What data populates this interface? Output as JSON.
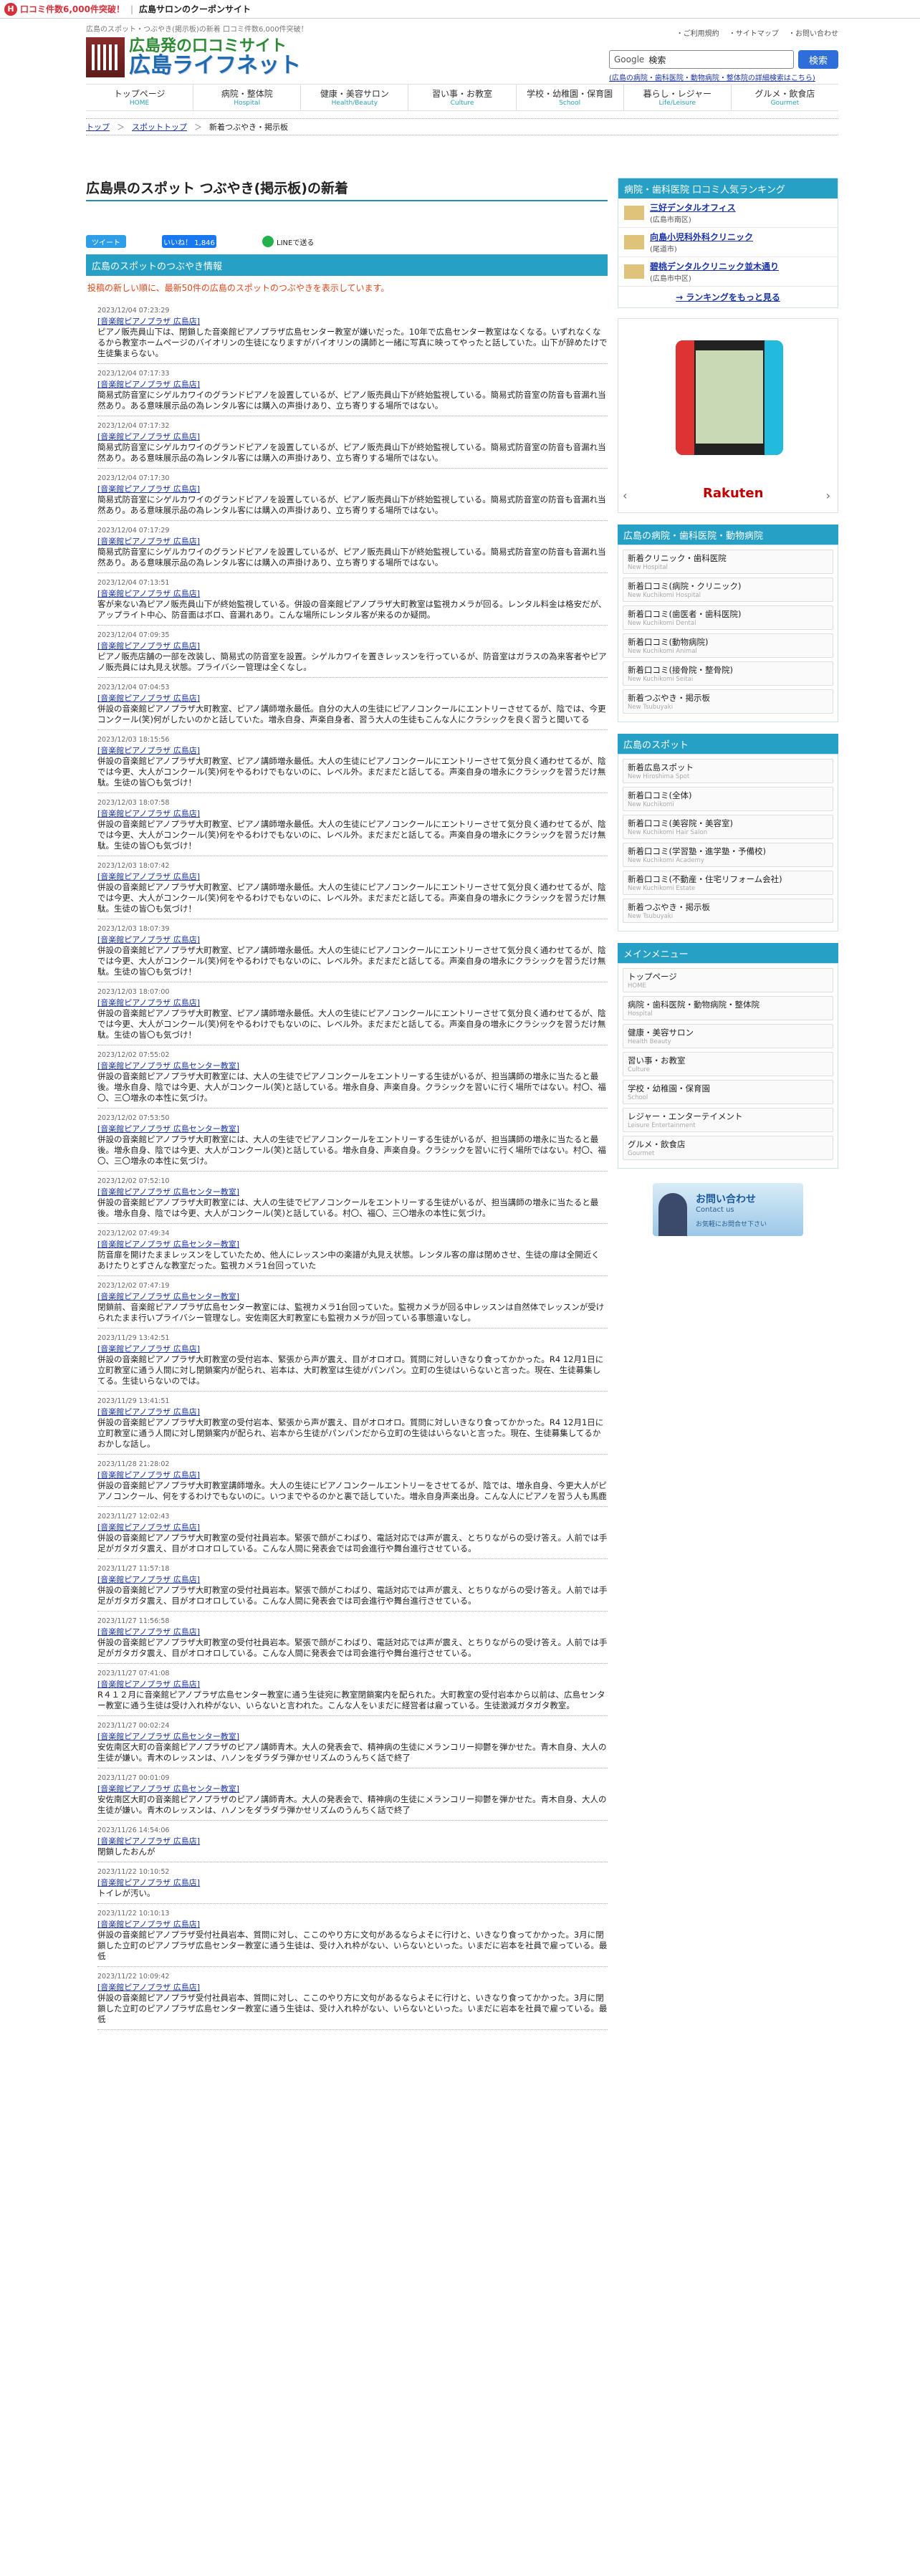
{
  "topbar": {
    "mark": "H",
    "promo": "口コミ件数6,000件突破！",
    "title": "広島サロンのクーポンサイト"
  },
  "header": {
    "tagline": "広島のスポット・つぶやき(掲示板)の新着 口コミ件数6,000件突破！",
    "utility": [
      "・ご利用規約",
      "・サイトマップ",
      "・お問い合わせ"
    ],
    "logo_line1": "広島発の口コミサイト",
    "logo_line2": "広島ライフネット",
    "search": {
      "brand": "Google",
      "placeholder": "検索",
      "button": "検索",
      "hint": "(広島の病院・歯科医院・動物病院・整体院の詳細検索はこちら)"
    }
  },
  "nav": [
    {
      "ja": "トップページ",
      "en": "HOME"
    },
    {
      "ja": "病院・整体院",
      "en": "Hospital"
    },
    {
      "ja": "健康・美容サロン",
      "en": "Health/Beauty"
    },
    {
      "ja": "習い事・お教室",
      "en": "Culture"
    },
    {
      "ja": "学校・幼稚園・保育園",
      "en": "School"
    },
    {
      "ja": "暮らし・レジャー",
      "en": "Life/Leisure"
    },
    {
      "ja": "グルメ・飲食店",
      "en": "Gourmet"
    }
  ],
  "breadcrumb": [
    "トップ",
    "スポットトップ",
    "新着つぶやき・掲示板"
  ],
  "page_title": "広島県のスポット つぶやき(掲示板)の新着",
  "social": {
    "twitter": "ツイート",
    "facebook": "いいね！ 1,846",
    "line": "LINEで送る"
  },
  "section": {
    "title": "広島のスポットのつぶやき情報",
    "note": "投稿の新しい順に、最新50件の広島のスポットのつぶやきを表示しています。"
  },
  "entries": [
    {
      "date": "2023/12/04 07:23:29",
      "shop": "[音楽館ピアノプラザ 広島店]",
      "text": "ピアノ販売員山下は、閉鎖した音楽館ピアノプラザ広島センター教室が嫌いだった。10年で広島センター教室はなくなる。いずれなくなるから教室ホームページのバイオリンの生徒になりますがバイオリンの講師と一緒に写真に映ってやったと話していた。山下が辞めたけで生徒集まらない。"
    },
    {
      "date": "2023/12/04 07:17:33",
      "shop": "[音楽館ピアノプラザ 広島店]",
      "text": "簡易式防音室にシゲルカワイのグランドピアノを設置しているが、ピアノ販売員山下が終始監視している。簡易式防音室の防音も音漏れ当然あり。ある意味展示品の為レンタル客には購入の声掛けあり、立ち寄りする場所ではない。"
    },
    {
      "date": "2023/12/04 07:17:32",
      "shop": "[音楽館ピアノプラザ 広島店]",
      "text": "簡易式防音室にシゲルカワイのグランドピアノを設置しているが、ピアノ販売員山下が終始監視している。簡易式防音室の防音も音漏れ当然あり。ある意味展示品の為レンタル客には購入の声掛けあり、立ち寄りする場所ではない。"
    },
    {
      "date": "2023/12/04 07:17:30",
      "shop": "[音楽館ピアノプラザ 広島店]",
      "text": "簡易式防音室にシゲルカワイのグランドピアノを設置しているが、ピアノ販売員山下が終始監視している。簡易式防音室の防音も音漏れ当然あり。ある意味展示品の為レンタル客には購入の声掛けあり、立ち寄りする場所ではない。"
    },
    {
      "date": "2023/12/04 07:17:29",
      "shop": "[音楽館ピアノプラザ 広島店]",
      "text": "簡易式防音室にシゲルカワイのグランドピアノを設置しているが、ピアノ販売員山下が終始監視している。簡易式防音室の防音も音漏れ当然あり。ある意味展示品の為レンタル客には購入の声掛けあり、立ち寄りする場所ではない。"
    },
    {
      "date": "2023/12/04 07:13:51",
      "shop": "[音楽館ピアノプラザ 広島店]",
      "text": "客が来ない為ピアノ販売員山下が終始監視している。併設の音楽館ピアノプラザ大町教室は監視カメラが回る。レンタル料金は格安だが、アップライト中心、防音面はボロ、音漏れあり。こんな場所にレンタル客が来るのか疑問。"
    },
    {
      "date": "2023/12/04 07:09:35",
      "shop": "[音楽館ピアノプラザ 広島店]",
      "text": "ピアノ販売店舗の一部を改装し、簡易式の防音室を設置。シゲルカワイを置きレッスンを行っているが、防音室はガラスの為来客者やピアノ販売員には丸見え状態。プライバシー管理は全くなし。"
    },
    {
      "date": "2023/12/04 07:04:53",
      "shop": "[音楽館ピアノプラザ 広島店]",
      "text": "併設の音楽館ピアノプラザ大町教室、ピアノ講師増永最低。自分の大人の生徒にピアノコンクールにエントリーさせてるが、陰では、今更コンクール(笑)何がしたいのかと話していた。増永自身、声楽自身者、習う大人の生徒もこんな人にクラシックを良く習うと聞いてる"
    },
    {
      "date": "2023/12/03 18:15:56",
      "shop": "[音楽館ピアノプラザ 広島店]",
      "text": "併設の音楽館ピアノプラザ大町教室、ピアノ講師増永最低。大人の生徒にピアノコンクールにエントリーさせて気分良く通わせてるが、陰では今更、大人がコンクール(笑)何をやるわけでもないのに、レベル外。まだまだと話してる。声楽自身の増永にクラシックを習うだけ無駄。生徒の皆〇も気づけ！"
    },
    {
      "date": "2023/12/03 18:07:58",
      "shop": "[音楽館ピアノプラザ 広島店]",
      "text": "併設の音楽館ピアノプラザ大町教室、ピアノ講師増永最低。大人の生徒にピアノコンクールにエントリーさせて気分良く通わせてるが、陰では今更、大人がコンクール(笑)何をやるわけでもないのに、レベル外。まだまだと話してる。声楽自身の増永にクラシックを習うだけ無駄。生徒の皆〇も気づけ！"
    },
    {
      "date": "2023/12/03 18:07:42",
      "shop": "[音楽館ピアノプラザ 広島店]",
      "text": "併設の音楽館ピアノプラザ大町教室、ピアノ講師増永最低。大人の生徒にピアノコンクールにエントリーさせて気分良く通わせてるが、陰では今更、大人がコンクール(笑)何をやるわけでもないのに、レベル外。まだまだと話してる。声楽自身の増永にクラシックを習うだけ無駄。生徒の皆〇も気づけ！"
    },
    {
      "date": "2023/12/03 18:07:39",
      "shop": "[音楽館ピアノプラザ 広島店]",
      "text": "併設の音楽館ピアノプラザ大町教室、ピアノ講師増永最低。大人の生徒にピアノコンクールにエントリーさせて気分良く通わせてるが、陰では今更、大人がコンクール(笑)何をやるわけでもないのに、レベル外。まだまだと話してる。声楽自身の増永にクラシックを習うだけ無駄。生徒の皆〇も気づけ！"
    },
    {
      "date": "2023/12/03 18:07:00",
      "shop": "[音楽館ピアノプラザ 広島店]",
      "text": "併設の音楽館ピアノプラザ大町教室、ピアノ講師増永最低。大人の生徒にピアノコンクールにエントリーさせて気分良く通わせてるが、陰では今更、大人がコンクール(笑)何をやるわけでもないのに、レベル外。まだまだと話してる。声楽自身の増永にクラシックを習うだけ無駄。生徒の皆〇も気づけ！"
    },
    {
      "date": "2023/12/02 07:55:02",
      "shop": "[音楽館ピアノプラザ 広島センター教室]",
      "text": "併設の音楽館ピアノプラザ大町教室には、大人の生徒でピアノコンクールをエントリーする生徒がいるが、担当講師の増永に当たると最後。増永自身、陰では今更、大人がコンクール(笑)と話している。増永自身、声楽自身。クラシックを習いに行く場所ではない。村〇、福〇、三〇増永の本性に気づけ。"
    },
    {
      "date": "2023/12/02 07:53:50",
      "shop": "[音楽館ピアノプラザ 広島センター教室]",
      "text": "併設の音楽館ピアノプラザ大町教室には、大人の生徒でピアノコンクールをエントリーする生徒がいるが、担当講師の増永に当たると最後。増永自身、陰では今更、大人がコンクール(笑)と話している。増永自身、声楽自身。クラシックを習いに行く場所ではない。村〇、福〇、三〇増永の本性に気づけ。"
    },
    {
      "date": "2023/12/02 07:52:10",
      "shop": "[音楽館ピアノプラザ 広島センター教室]",
      "text": "併設の音楽館ピアノプラザ大町教室には、大人の生徒でピアノコンクールをエントリーする生徒がいるが、担当講師の増永に当たると最後。増永自身、陰では今更、大人がコンクール(笑)と話している。村〇、福〇、三〇増永の本性に気づけ。"
    },
    {
      "date": "2023/12/02 07:49:34",
      "shop": "[音楽館ピアノプラザ 広島センター教室]",
      "text": "防音扉を開けたままレッスンをしていたため、他人にレッスン中の楽譜が丸見え状態。レンタル客の扉は閉めさせ、生徒の扉は全開近くあけたりとずさんな教室だった。監視カメラ1台回っていた"
    },
    {
      "date": "2023/12/02 07:47:19",
      "shop": "[音楽館ピアノプラザ 広島センター教室]",
      "text": "閉鎖前、音楽館ピアノプラザ広島センター教室には、監視カメラ1台回っていた。監視カメラが回る中レッスンは自然体でレッスンが受けられたまま行いプライバシー管理なし。安佐南区大町教室にも監視カメラが回っている事態違いなし。"
    },
    {
      "date": "2023/11/29 13:42:51",
      "shop": "[音楽館ピアノプラザ 広島店]",
      "text": "併設の音楽館ピアノプラザ大町教室の受付岩本、緊張から声が震え、目がオロオロ。質問に対しいきなり食ってかかった。R4 12月1日に立町教室に通う人間に対し閉鎖案内が配られ、岩本は、大町教室は生徒がパンパン。立町の生徒はいらないと言った。現在、生徒募集してる。生徒いらないのでは。"
    },
    {
      "date": "2023/11/29 13:41:51",
      "shop": "[音楽館ピアノプラザ 広島店]",
      "text": "併設の音楽館ピアノプラザ大町教室の受付岩本、緊張から声が震え、目がオロオロ。質問に対しいきなり食ってかかった。R4 12月1日に立町教室に通う人間に対し閉鎖案内が配られ、岩本から生徒がパンパンだから立町の生徒はいらないと言った。現在、生徒募集してるかおかしな話し。"
    },
    {
      "date": "2023/11/28 21:28:02",
      "shop": "[音楽館ピアノプラザ 広島店]",
      "text": "併設の音楽館ピアノプラザ大町教室講師増永。大人の生徒にピアノコンクールエントリーをさせてるが、陰では、増永自身、今更大人がピアノコンクール、何をするわけでもないのに。いつまでやるのかと裏で話していた。増永自身声楽出身。こんな人にピアノを習う人も馬鹿"
    },
    {
      "date": "2023/11/27 12:02:43",
      "shop": "[音楽館ピアノプラザ 広島店]",
      "text": "併設の音楽館ピアノプラザ大町教室の受付社員岩本。緊張で顔がこわばり、電話対応では声が震え、とちりながらの受け答え。人前では手足がガタガタ震え、目がオロオロしている。こんな人間に発表会では司会進行や舞台進行させている。"
    },
    {
      "date": "2023/11/27 11:57:18",
      "shop": "[音楽館ピアノプラザ 広島店]",
      "text": "併設の音楽館ピアノプラザ大町教室の受付社員岩本。緊張で顔がこわばり、電話対応では声が震え、とちりながらの受け答え。人前では手足がガタガタ震え、目がオロオロしている。こんな人間に発表会では司会進行や舞台進行させている。"
    },
    {
      "date": "2023/11/27 11:56:58",
      "shop": "[音楽館ピアノプラザ 広島店]",
      "text": "併設の音楽館ピアノプラザ大町教室の受付社員岩本。緊張で顔がこわばり、電話対応では声が震え、とちりながらの受け答え。人前では手足がガタガタ震え、目がオロオロしている。こんな人間に発表会では司会進行や舞台進行させている。"
    },
    {
      "date": "2023/11/27 07:41:08",
      "shop": "[音楽館ピアノプラザ 広島店]",
      "text": "R４１２月に音楽館ピアノプラザ広島センター教室に通う生徒宛に教室閉鎖案内を配られた。大町教室の受付岩本から以前は、広島センター教室に通う生徒は受け入れ枠がない、いらないと言われた。こんな人をいまだに経営者は雇っている。生徒激減ガタガタ教室。"
    },
    {
      "date": "2023/11/27 00:02:24",
      "shop": "[音楽館ピアノプラザ 広島センター教室]",
      "text": "安佐南区大町の音楽館ピアノプラザのピアノ講師青木。大人の発表会で、精神病の生徒にメランコリー抑鬱を弾かせた。青木自身、大人の生徒が嫌い。青木のレッスンは、ハノンをダラダラ弾かせリズムのうんちく話で終了"
    },
    {
      "date": "2023/11/27 00:01:09",
      "shop": "[音楽館ピアノプラザ 広島センター教室]",
      "text": "安佐南区大町の音楽館ピアノプラザのピアノ講師青木。大人の発表会で、精神病の生徒にメランコリー抑鬱を弾かせた。青木自身、大人の生徒が嫌い。青木のレッスンは、ハノンをダラダラ弾かせリズムのうんちく話で終了"
    },
    {
      "date": "2023/11/26 14:54:06",
      "shop": "[音楽館ピアノプラザ 広島店]",
      "text": "閉鎖したおんが"
    },
    {
      "date": "2023/11/22 10:10:52",
      "shop": "[音楽館ピアノプラザ 広島店]",
      "text": "トイレが汚い。"
    },
    {
      "date": "2023/11/22 10:10:13",
      "shop": "[音楽館ピアノプラザ 広島店]",
      "text": "併設の音楽館ピアノプラザ受付社員岩本、質問に対し、ここのやり方に文句があるならよそに行けと、いきなり食ってかかった。3月に閉鎖した立町のピアノプラザ広島センター教室に通う生徒は、受け入れ枠がない、いらないといった。いまだに岩本を社員で雇っている。最低"
    },
    {
      "date": "2023/11/22 10:09:42",
      "shop": "[音楽館ピアノプラザ 広島店]",
      "text": "併設の音楽館ピアノプラザ受付社員岩本、質問に対し、ここのやり方に文句があるならよそに行けと、いきなり食ってかかった。3月に閉鎖した立町のピアノプラザ広島センター教室に通う生徒は、受け入れ枠がない、いらないといった。いまだに岩本を社員で雇っている。最低"
    }
  ],
  "sidebar": {
    "ranking": {
      "title": "病院・歯科医院 口コミ人気ランキング",
      "items": [
        {
          "name": "三好デンタルオフィス",
          "sub": "(広島市南区)"
        },
        {
          "name": "向島小児科外科クリニック",
          "sub": "(尾道市)"
        },
        {
          "name": "碧桃デンタルクリニック並木通り",
          "sub": "(広島市中区)"
        }
      ],
      "more": "→ ランキングをもっと見る"
    },
    "ad": {
      "brand": "Rakuten",
      "prev": "‹",
      "info": "ⓘ",
      "next": "›"
    },
    "hospital": {
      "title": "広島の病院・歯科医院・動物病院",
      "items": [
        {
          "a": "新着クリニック・歯科医院",
          "b": "New Hospital"
        },
        {
          "a": "新着口コミ(病院・クリニック)",
          "b": "New Kuchikomi Hospital"
        },
        {
          "a": "新着口コミ(歯医者・歯科医院)",
          "b": "New Kuchikomi Dental"
        },
        {
          "a": "新着口コミ(動物病院)",
          "b": "New Kuchikomi Animal"
        },
        {
          "a": "新着口コミ(接骨院・整骨院)",
          "b": "New Kuchikomi Seitai"
        },
        {
          "a": "新着つぶやき・掲示板",
          "b": "New Tsubuyaki"
        }
      ]
    },
    "spot": {
      "title": "広島のスポット",
      "items": [
        {
          "a": "新着広島スポット",
          "b": "New Hiroshima Spot"
        },
        {
          "a": "新着口コミ(全体)",
          "b": "New Kuchikomi"
        },
        {
          "a": "新着口コミ(美容院・美容室)",
          "b": "New Kuchikomi Hair Salon"
        },
        {
          "a": "新着口コミ(学習塾・進学塾・予備校)",
          "b": "New Kuchikomi Academy"
        },
        {
          "a": "新着口コミ(不動産・住宅リフォーム会社)",
          "b": "New Kuchikomi Estate"
        },
        {
          "a": "新着つぶやき・掲示板",
          "b": "New Tsubuyaki"
        }
      ]
    },
    "menu": {
      "title": "メインメニュー",
      "items": [
        {
          "a": "トップページ",
          "b": "HOME"
        },
        {
          "a": "病院・歯科医院・動物病院・整体院",
          "b": "Hospital"
        },
        {
          "a": "健康・美容サロン",
          "b": "Health Beauty"
        },
        {
          "a": "習い事・お教室",
          "b": "Culture"
        },
        {
          "a": "学校・幼稚園・保育園",
          "b": "School"
        },
        {
          "a": "レジャー・エンターテイメント",
          "b": "Leisure Entertainment"
        },
        {
          "a": "グルメ・飲食店",
          "b": "Gourmet"
        }
      ]
    },
    "contact": {
      "title": "お問い合わせ",
      "en": "Contact us",
      "sub": "お気軽にお問合せ下さい"
    }
  }
}
